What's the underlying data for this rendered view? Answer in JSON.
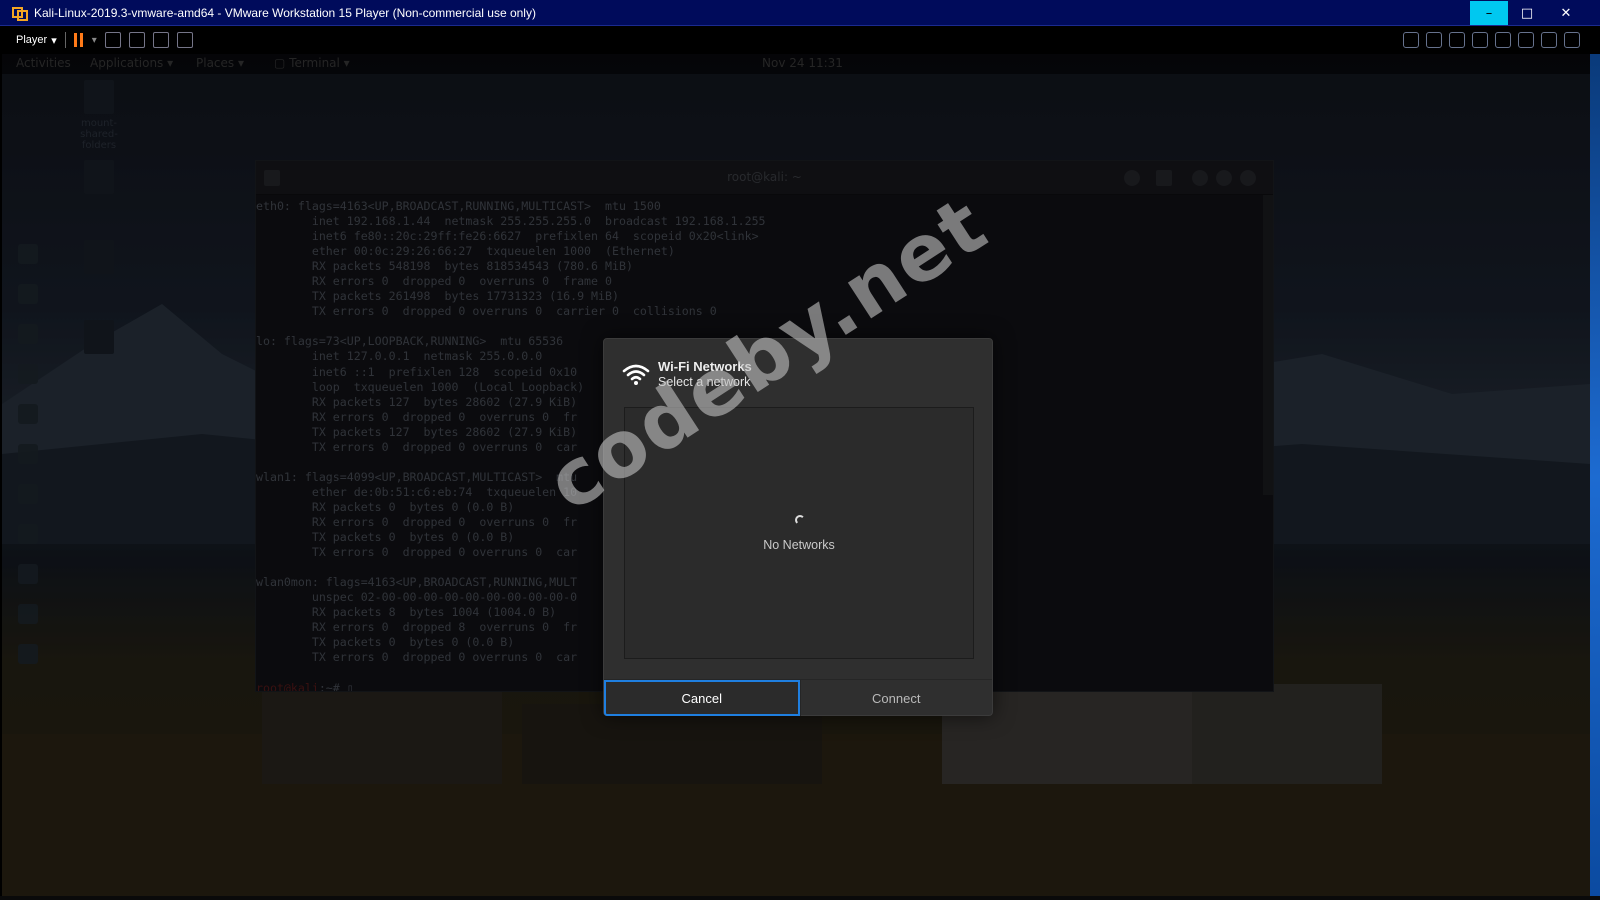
{
  "vmware": {
    "window_title": "Kali-Linux-2019.3-vmware-amd64 - VMware Workstation 15 Player (Non-commercial use only)",
    "player_menu_label": "Player",
    "controls": {
      "minimize": "–",
      "maximize": "□",
      "close": "✕"
    }
  },
  "wifi_dialog": {
    "title": "Wi-Fi Networks",
    "subtitle": "Select a network",
    "empty_state": "No Networks",
    "cancel_label": "Cancel",
    "connect_label": "Connect"
  },
  "watermark": "codeby.net",
  "colors": {
    "focus_ring": "#1f7fe0",
    "dialog_bg": "#2f2f2f",
    "vm_titlebar": "#000b5b",
    "pause_orange": "#ff7a18"
  }
}
